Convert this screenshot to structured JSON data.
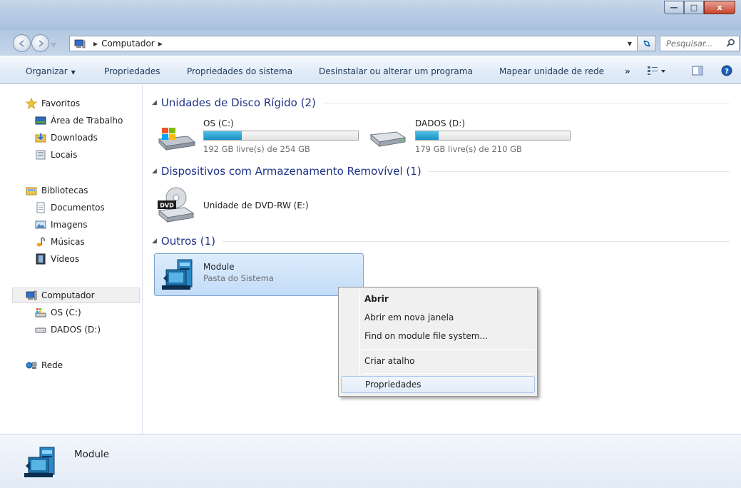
{
  "window": {
    "minimize_glyph": "—",
    "maximize_glyph": "□",
    "close_glyph": "x"
  },
  "address": {
    "breadcrumb": [
      "Computador"
    ],
    "search_placeholder": "Pesquisar..."
  },
  "toolbar": {
    "organize": "Organizar",
    "properties": "Propriedades",
    "system_properties": "Propriedades do sistema",
    "uninstall": "Desinstalar ou alterar um programa",
    "map_drive": "Mapear unidade de rede",
    "more": "»"
  },
  "sidebar": {
    "favorites": "Favoritos",
    "desktop": "Área de Trabalho",
    "downloads": "Downloads",
    "places": "Locais",
    "libraries": "Bibliotecas",
    "documents": "Documentos",
    "images": "Imagens",
    "music": "Músicas",
    "videos": "Vídeos",
    "computer": "Computador",
    "drive_c": "OS (C:)",
    "drive_d": "DADOS (D:)",
    "network": "Rede"
  },
  "groups": {
    "hard_disks": "Unidades de Disco Rígido (2)",
    "removable": "Dispositivos com Armazenamento Removível (1)",
    "others": "Outros (1)"
  },
  "drives": [
    {
      "name": "OS (C:)",
      "free_text": "192 GB livre(s) de 254 GB",
      "used_fraction": 0.244
    },
    {
      "name": "DADOS (D:)",
      "free_text": "179 GB livre(s) de 210 GB",
      "used_fraction": 0.148
    }
  ],
  "dvd": {
    "name": "Unidade de DVD-RW (E:)",
    "icon_label": "DVD"
  },
  "module": {
    "name": "Module",
    "type": "Pasta do Sistema"
  },
  "context_menu": {
    "open": "Abrir",
    "open_new_window": "Abrir em nova janela",
    "find_on_module": "Find on module file system...",
    "create_shortcut": "Criar atalho",
    "properties": "Propriedades"
  },
  "details": {
    "name": "Module"
  },
  "colors": {
    "bar_fill": "#26a0da",
    "group_title": "#1e3287"
  }
}
